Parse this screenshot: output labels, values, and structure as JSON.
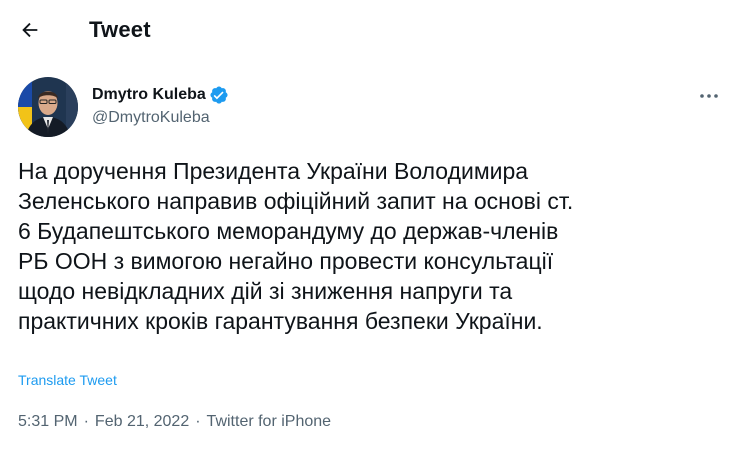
{
  "header": {
    "title": "Tweet",
    "back_icon": "arrow-left-icon"
  },
  "tweet": {
    "author": {
      "name": "Dmytro Kuleba",
      "handle": "@DmytroKuleba",
      "verified": true,
      "verified_icon": "verified-badge-icon",
      "avatar_icon": "avatar-photo"
    },
    "more_icon": "more-horizontal-icon",
    "text": "На доручення Президента України Володимира\nЗеленського направив офіційний запит на основі ст.\n6 Будапештського меморандуму до держав-членів\nРБ ООН з вимогою негайно провести консультації\nщодо невідкладних дій зі зниження напруги та\nпрактичних кроків гарантування безпеки України.",
    "translate_label": "Translate Tweet",
    "time": "5:31 PM",
    "date": "Feb 21, 2022",
    "source": "Twitter for iPhone",
    "separator": "·"
  },
  "colors": {
    "text": "#0f1419",
    "secondary": "#536471",
    "accent": "#1d9bf0"
  }
}
